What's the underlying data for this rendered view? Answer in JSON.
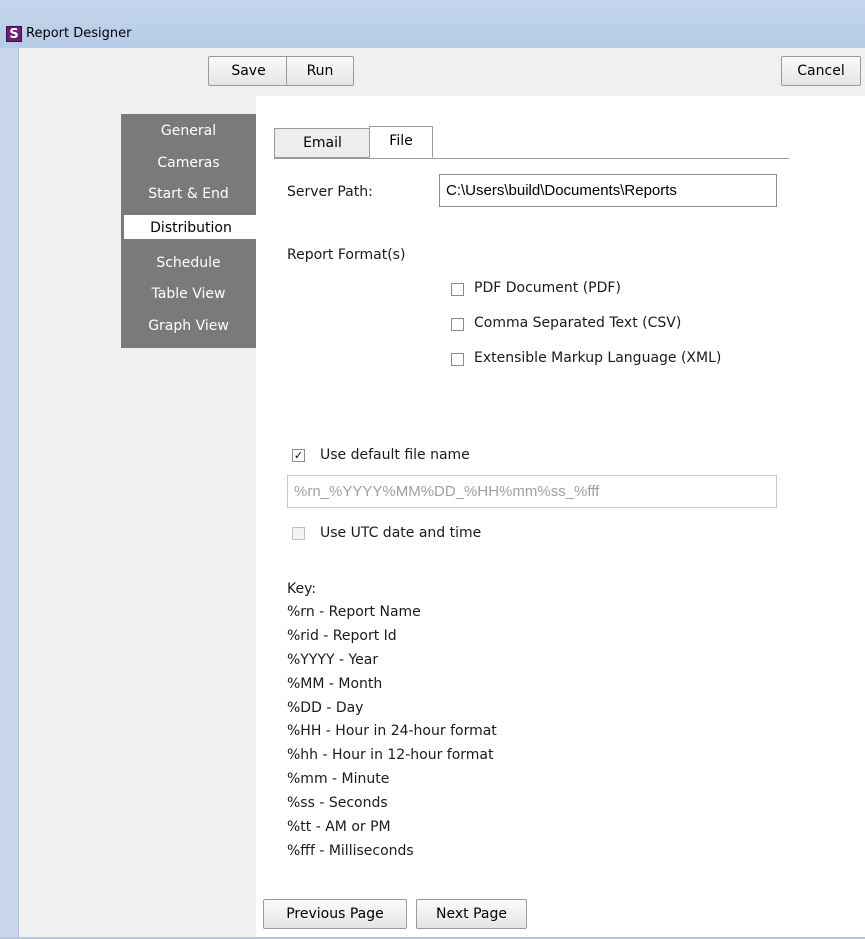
{
  "window": {
    "title": "Report Designer",
    "icon_letter": "S"
  },
  "toolbar": {
    "save_label": "Save",
    "run_label": "Run",
    "cancel_label": "Cancel"
  },
  "nav": {
    "items": [
      {
        "label": "General"
      },
      {
        "label": "Cameras"
      },
      {
        "label": "Start & End"
      },
      {
        "label": "Distribution",
        "selected": true
      },
      {
        "label": "Schedule"
      },
      {
        "label": "Table View"
      },
      {
        "label": "Graph View"
      }
    ]
  },
  "tabs": [
    {
      "label": "Email",
      "active": false
    },
    {
      "label": "File",
      "active": true
    }
  ],
  "server_path": {
    "label": "Server Path:",
    "value": "C:\\Users\\build\\Documents\\Reports"
  },
  "report_format": {
    "label": "Report Format(s)",
    "options": [
      {
        "label": "PDF Document (PDF)",
        "checked": false
      },
      {
        "label": "Comma Separated Text (CSV)",
        "checked": false
      },
      {
        "label": "Extensible Markup Language (XML)",
        "checked": false
      }
    ]
  },
  "default_file_name": {
    "label": "Use default file name",
    "checked": true,
    "value": "%rn_%YYYY%MM%DD_%HH%mm%ss_%fff"
  },
  "utc": {
    "label": "Use UTC date and time",
    "checked": false,
    "disabled": true
  },
  "key": {
    "title": "Key:",
    "lines": [
      "%rn - Report Name",
      "%rid - Report Id",
      "%YYYY - Year",
      "%MM - Month",
      "%DD - Day",
      "%HH - Hour in 24-hour format",
      "%hh - Hour in 12-hour format",
      "%mm - Minute",
      "%ss - Seconds",
      "%tt - AM or PM",
      "%fff - Milliseconds"
    ]
  },
  "footer": {
    "previous_label": "Previous Page",
    "next_label": "Next Page"
  }
}
